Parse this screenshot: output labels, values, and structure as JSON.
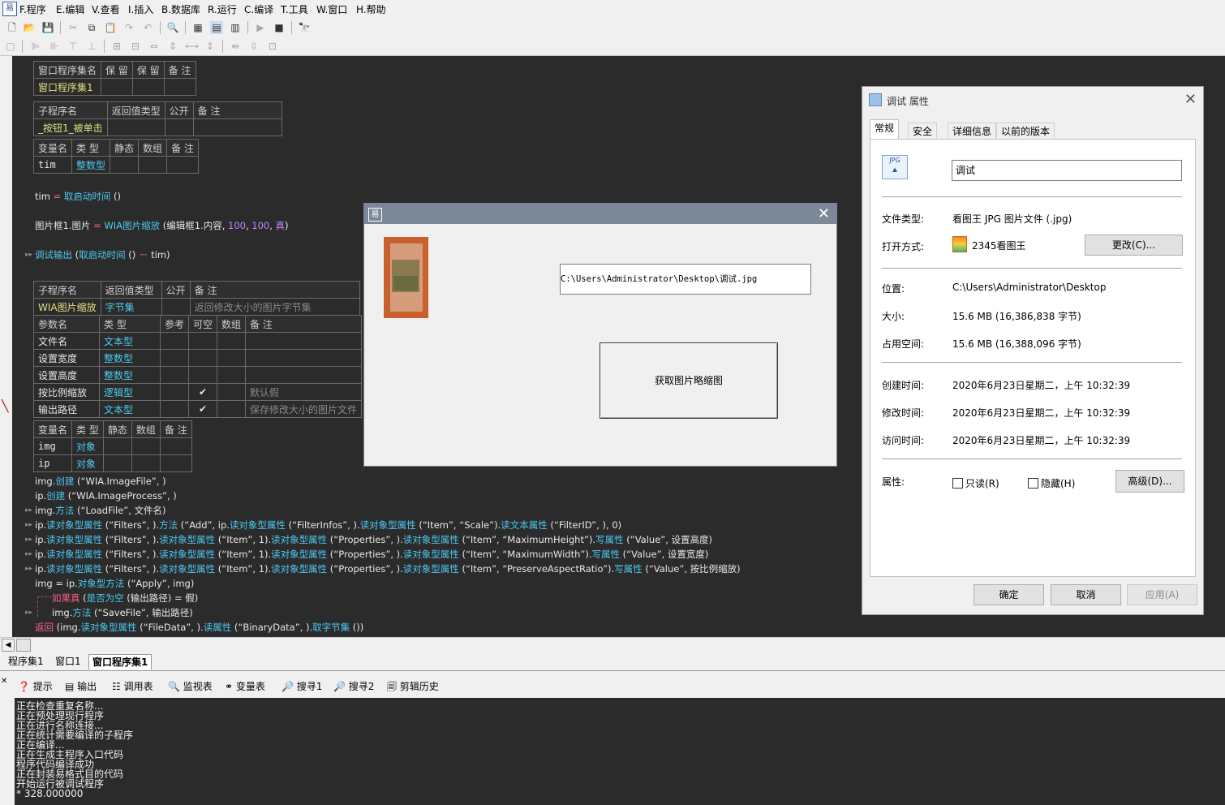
{
  "menu": [
    "F.程序",
    "E.编辑",
    "V.查看",
    "I.插入",
    "B.数据库",
    "R.运行",
    "C.编译",
    "T.工具",
    "W.窗口",
    "H.帮助"
  ],
  "assembly_table": {
    "headers": [
      "窗口程序集名",
      "保 留",
      "保 留",
      "备 注"
    ],
    "row": [
      "窗口程序集1",
      "",
      "",
      ""
    ]
  },
  "sub1_table": {
    "headers": [
      "子程序名",
      "返回值类型",
      "公开",
      "备 注"
    ],
    "row": [
      "_按钮1_被单击",
      "",
      "",
      ""
    ]
  },
  "var1_table": {
    "headers": [
      "变量名",
      "类 型",
      "静态",
      "数组",
      "备 注"
    ],
    "row": [
      "tim",
      "整数型",
      "",
      "",
      ""
    ]
  },
  "code1": {
    "line1": {
      "a": "tim",
      "b": " = ",
      "c": "取启动时间",
      "d": " ()"
    },
    "line2": {
      "a": "图片框1.图片",
      "b": " = ",
      "c": "WIA图片缩放",
      "d": " (编辑框1.内容, ",
      "e": "100",
      "f": ", ",
      "g": "100",
      "h": ", ",
      "i": "真",
      "j": ")"
    },
    "line3": {
      "a": "调试输出",
      "b": " (",
      "c": "取启动时间",
      "d": " () ",
      "e": "－",
      "f": " tim)"
    }
  },
  "sub2_table": {
    "headers": [
      "子程序名",
      "返回值类型",
      "公开",
      "备 注"
    ],
    "row": [
      "WIA图片缩放",
      "字节集",
      "",
      "返回修改大小的图片字节集"
    ]
  },
  "param_table": {
    "headers": [
      "参数名",
      "类 型",
      "参考",
      "可空",
      "数组",
      "备 注"
    ],
    "rows": [
      [
        "文件名",
        "文本型",
        "",
        "",
        "",
        ""
      ],
      [
        "设置宽度",
        "整数型",
        "",
        "",
        "",
        ""
      ],
      [
        "设置高度",
        "整数型",
        "",
        "",
        "",
        ""
      ],
      [
        "按比例缩放",
        "逻辑型",
        "",
        "✔",
        "",
        "默认假"
      ],
      [
        "输出路径",
        "文本型",
        "",
        "✔",
        "",
        "保存修改大小的图片文件"
      ]
    ]
  },
  "var2_table": {
    "headers": [
      "变量名",
      "类 型",
      "静态",
      "数组",
      "备 注"
    ],
    "rows": [
      [
        "img",
        "对象",
        "",
        "",
        ""
      ],
      [
        "ip",
        "对象",
        "",
        "",
        ""
      ]
    ]
  },
  "code2": [
    {
      "a": "img.",
      "b": "创建",
      "c": " (“WIA.ImageFile”, )"
    },
    {
      "a": "ip.",
      "b": "创建",
      "c": " (“WIA.ImageProcess”, )"
    },
    {
      "a": "img.",
      "b": "方法",
      "c": " (“LoadFile”, 文件名)"
    },
    {
      "a": "ip.",
      "b": "读对象型属性",
      "c": " (“Filters”, ).",
      "d": "方法",
      "e": " (“Add”, ip.",
      "f": "读对象型属性",
      "g": " (“FilterInfos”, ).",
      "h": "读对象型属性",
      "i": " (“Item”, “Scale”).",
      "j": "读文本属性",
      "k": " (“FilterID”, ), 0)"
    },
    {
      "a": "ip.",
      "b": "读对象型属性",
      "c": " (“Filters”, ).",
      "d": "读对象型属性",
      "e": " (“Item”, 1).",
      "f": "读对象型属性",
      "g": " (“Properties”, ).",
      "h": "读对象型属性",
      "i": " (“Item”, “MaximumHeight”).",
      "j": "写属性",
      "k": " (“Value”, 设置高度)"
    },
    {
      "a": "ip.",
      "b": "读对象型属性",
      "c": " (“Filters”, ).",
      "d": "读对象型属性",
      "e": " (“Item”, 1).",
      "f": "读对象型属性",
      "g": " (“Properties”, ).",
      "h": "读对象型属性",
      "i": " (“Item”, “MaximumWidth”).",
      "j": "写属性",
      "k": " (“Value”, 设置宽度)"
    },
    {
      "a": "ip.",
      "b": "读对象型属性",
      "c": " (“Filters”, ).",
      "d": "读对象型属性",
      "e": " (“Item”, 1).",
      "f": "读对象型属性",
      "g": " (“Properties”, ).",
      "h": "读对象型属性",
      "i": " (“Item”, “PreserveAspectRatio”).",
      "j": "写属性",
      "k": " (“Value”, 按比例缩放)"
    },
    {
      "a": "img = ip.",
      "b": "对象型方法",
      "c": " (“Apply”, img)"
    },
    {
      "a": "如果真",
      "b": " (",
      "c": "是否为空",
      "d": " (输出路径) = 假)"
    },
    {
      "a": "img.",
      "b": "方法",
      "c": " (“SaveFile”, 输出路径)"
    },
    {
      "a": "返回",
      "b": " (img.",
      "c": "读对象型属性",
      "d": " (“FileData”, ).",
      "e": "读属性",
      "f": " (“BinaryData”, ).",
      "g": "取字节集",
      "h": " ())"
    }
  ],
  "tabs": [
    "程序集1",
    "窗口1",
    "窗口程序集1"
  ],
  "bottom_tabs": [
    "提示",
    "输出",
    "调用表",
    "监视表",
    "变量表",
    "搜寻1",
    "搜寻2",
    "剪辑历史"
  ],
  "output_lines": [
    "正在检查重复名称...",
    "正在预处理现行程序",
    "正在进行名称连接...",
    "正在统计需要编译的子程序",
    "正在编译...",
    "正在生成主程序入口代码",
    "程序代码编译成功",
    "正在封装易格式目的代码",
    "开始运行被调试程序",
    "* 328.000000"
  ],
  "dialog": {
    "path": "C:\\Users\\Administrator\\Desktop\\调试.jpg",
    "button": "获取图片略缩图"
  },
  "props": {
    "title": "调试 属性",
    "tabs": [
      "常规",
      "安全",
      "详细信息",
      "以前的版本"
    ],
    "filename": "调试",
    "rows": {
      "type_label": "文件类型:",
      "type_value": "看图王 JPG 图片文件 (.jpg)",
      "open_label": "打开方式:",
      "open_value": "2345看图王",
      "change_btn": "更改(C)...",
      "loc_label": "位置:",
      "loc_value": "C:\\Users\\Administrator\\Desktop",
      "size_label": "大小:",
      "size_value": "15.6 MB (16,386,838 字节)",
      "disk_label": "占用空间:",
      "disk_value": "15.6 MB (16,388,096 字节)",
      "created_label": "创建时间:",
      "created_value": "2020年6月23日星期二，上午 10:32:39",
      "modified_label": "修改时间:",
      "modified_value": "2020年6月23日星期二，上午 10:32:39",
      "accessed_label": "访问时间:",
      "accessed_value": "2020年6月23日星期二，上午 10:32:39",
      "attr_label": "属性:",
      "readonly": "只读(R)",
      "hidden": "隐藏(H)",
      "advanced": "高级(D)..."
    },
    "ok": "确定",
    "cancel": "取消",
    "apply": "应用(A)"
  },
  "icons": {
    "app": "easy-language-logo",
    "jpg": "jpg-file-icon",
    "viewer": "2345-viewer-icon"
  },
  "colors": {
    "editor_bg": "#2b2b2b",
    "keyword": "#4cc8f0",
    "operator": "#ff5e8a",
    "number": "#c586ff",
    "name": "#e0e080"
  }
}
